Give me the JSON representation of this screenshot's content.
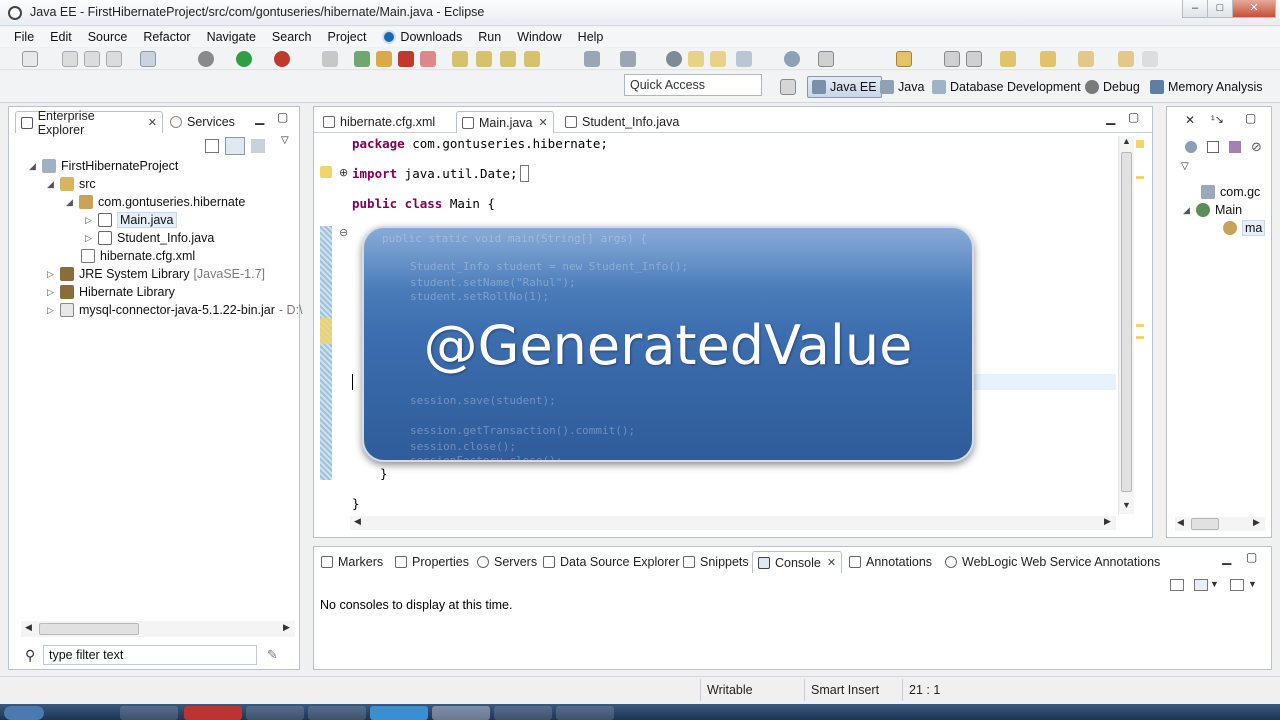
{
  "window": {
    "title": "Java EE - FirstHibernateProject/src/com/gontuseries/hibernate/Main.java - Eclipse"
  },
  "menu": [
    "File",
    "Edit",
    "Source",
    "Refactor",
    "Navigate",
    "Search",
    "Project",
    "Downloads",
    "Run",
    "Window",
    "Help"
  ],
  "toolbar": {
    "quick_access_placeholder": "Quick Access"
  },
  "perspectives": [
    "Java EE",
    "Java",
    "Database Development",
    "Debug",
    "Memory Analysis"
  ],
  "explorer": {
    "tabs": [
      "Enterprise Explorer",
      "Services"
    ],
    "tree": [
      {
        "label": "FirstHibernateProject",
        "sub": ""
      },
      {
        "label": "src",
        "sub": ""
      },
      {
        "label": "com.gontuseries.hibernate",
        "sub": ""
      },
      {
        "label": "Main.java",
        "sub": ""
      },
      {
        "label": "Student_Info.java",
        "sub": ""
      },
      {
        "label": "hibernate.cfg.xml",
        "sub": ""
      },
      {
        "label": "JRE System Library",
        "sub": "[JavaSE-1.7]"
      },
      {
        "label": "Hibernate Library",
        "sub": ""
      },
      {
        "label": "mysql-connector-java-5.1.22-bin.jar",
        "sub": "- D:\\"
      }
    ],
    "filter_placeholder": "type filter text"
  },
  "editor": {
    "tabs": [
      "hibernate.cfg.xml",
      "Main.java",
      "Student_Info.java"
    ],
    "lines": {
      "package_kw": "package",
      "package_rest": " com.gontuseries.hibernate;",
      "import_kw": "import",
      "import_rest": " java.util.Date;",
      "class_kw": "public class",
      "class_rest": " Main {",
      "close_inner": "}",
      "close_outer": "}"
    },
    "ghost": [
      "public static void main(String[] args) {",
      "Student_Info student = new Student_Info();",
      "student.setName(\"Rahul\");",
      "student.setRollNo(1);",
      "session.save(student);",
      "session.getTransaction().commit();",
      "session.close();",
      "sessionFactory.close();"
    ],
    "overlay_text": "@GeneratedValue"
  },
  "outline": {
    "items": [
      "com.gc",
      "Main",
      "ma"
    ]
  },
  "bottom": {
    "tabs": [
      "Markers",
      "Properties",
      "Servers",
      "Data Source Explorer",
      "Snippets",
      "Console",
      "Annotations",
      "WebLogic Web Service Annotations"
    ],
    "console_message": "No consoles to display at this time."
  },
  "status": {
    "writable": "Writable",
    "insert_mode": "Smart Insert",
    "position": "21 : 1"
  }
}
